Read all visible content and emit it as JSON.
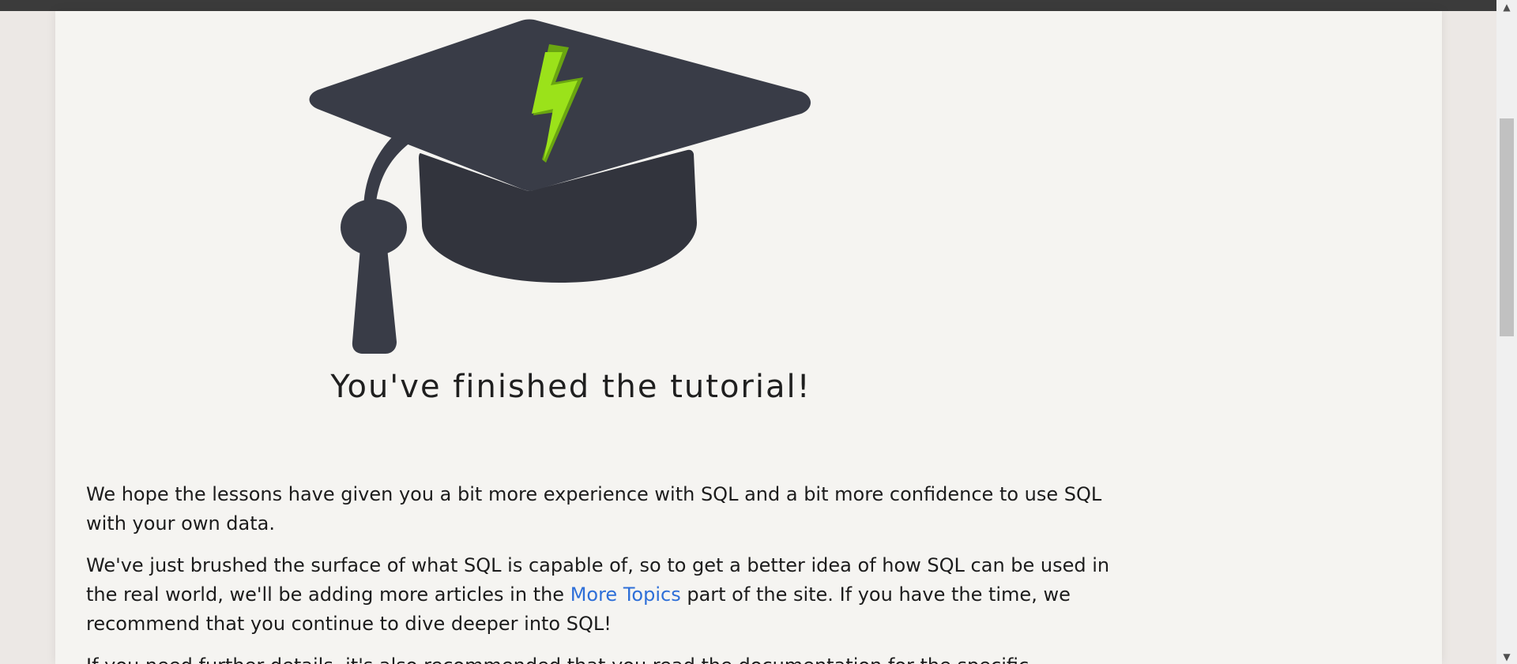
{
  "tutorial": {
    "finish_title": "You've finished the tutorial!",
    "paragraphs": {
      "p1": "We hope the lessons have given you a bit more experience with SQL and a bit more confidence to use SQL with your own data.",
      "p2_before_link": "We've just brushed the surface of what SQL is capable of, so to get a better idea of how SQL can be used in the real world, we'll be adding more articles in the ",
      "p2_link": "More Topics",
      "p2_after_link": " part of the site. If you have the time, we recommend that you continue to dive deeper into SQL!",
      "p3": "If you need further details, it's also recommended that you read the documentation for the specific"
    }
  },
  "scrollbar": {
    "up_arrow": "▲",
    "down_arrow": "▼"
  },
  "colors": {
    "cap": "#393c47",
    "bolt": "#9be21a",
    "link": "#2e6fd8",
    "page_bg": "#f5f4f1"
  }
}
